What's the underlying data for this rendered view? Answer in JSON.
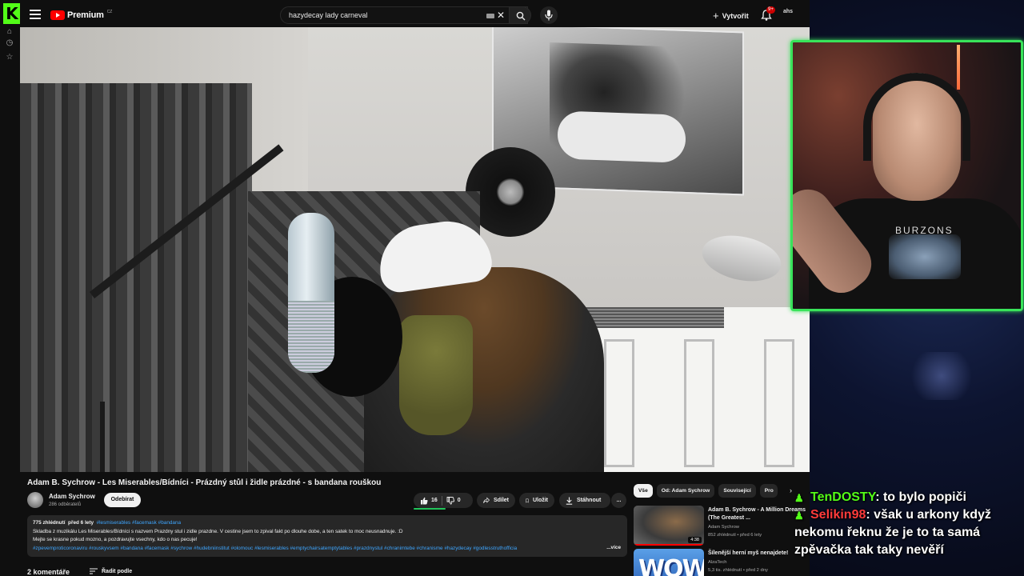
{
  "rail": {
    "logo": "K"
  },
  "header": {
    "brand": "Premium",
    "brand_region": "CZ",
    "search_query": "hazydecay lady carneval",
    "create_label": "Vytvořit",
    "notif_badge": "9+",
    "avatar_text": "ahs"
  },
  "video": {
    "title": "Adam B. Sychrow - Les Miserables/Bídníci - Prázdný stůl i židle prázdné - s bandana rouškou",
    "channel": "Adam Sychrow",
    "subscribers": "286 odběratelů",
    "subscribe_label": "Odebírat",
    "likes": "16",
    "dislikes": "0",
    "share_label": "Sdílet",
    "save_label": "Uložit",
    "download_label": "Stáhnout",
    "more_label": "..."
  },
  "description": {
    "views": "775 zhlédnutí",
    "age": "před 6 lety",
    "top_tags": "#lesmiserables #facemask #bandana",
    "line1": "Skladba z muzikálu Les Miserables/Bídníci s nazvem Prazdny stul i zidle prazdne. V cestine jsem to zpival fakt po dlouhe dobe, a ten satek to moc neusnadnuje. :D",
    "line2": "Mejte se krasne pokud mozno, a pozdravujte vsechny, kdo o nas pecuje!",
    "tags": "#zpevemproticoronaviru #rouskyvsem #bandana #facemask #sychrow #hudebniinstitut #olomouc #lesmiserables #emptychairsatemptytables #prazdnystul #chranimtebe #chranisme #hazydecay #godlesstruthofficia",
    "more": "...více"
  },
  "comments": {
    "count_label": "2 komentáře",
    "sort_label": "Řadit podle"
  },
  "chips": [
    "Vše",
    "Od: Adam Sychrow",
    "Související",
    "Pro"
  ],
  "recommendations": [
    {
      "title": "Adam B. Sychrow - A Million Dreams (The Greatest ...",
      "channel": "Adam Sychrow",
      "meta": "852 zhlédnutí • před 6 lety",
      "duration": "4:38"
    },
    {
      "title": "Šílenější herní myš nenajdete!",
      "channel": "AlzaTech",
      "meta": "5,3 tis. zhlédnutí • před 2 dny",
      "thumb_text": "WOW"
    }
  ],
  "webcam": {
    "shirt_text": "BURZONS"
  },
  "chat": [
    {
      "user": "TenDOSTY",
      "message": ": to bylo popiči"
    },
    {
      "user": "Selikin98",
      "message": ": však u arkony když nekomu řeknu že je to ta samá zpěvačka tak taky nevěří"
    }
  ],
  "colors": {
    "accent_kick": "#53fc18",
    "youtube_red": "#ff0000",
    "link_blue": "#3ea6ff"
  }
}
